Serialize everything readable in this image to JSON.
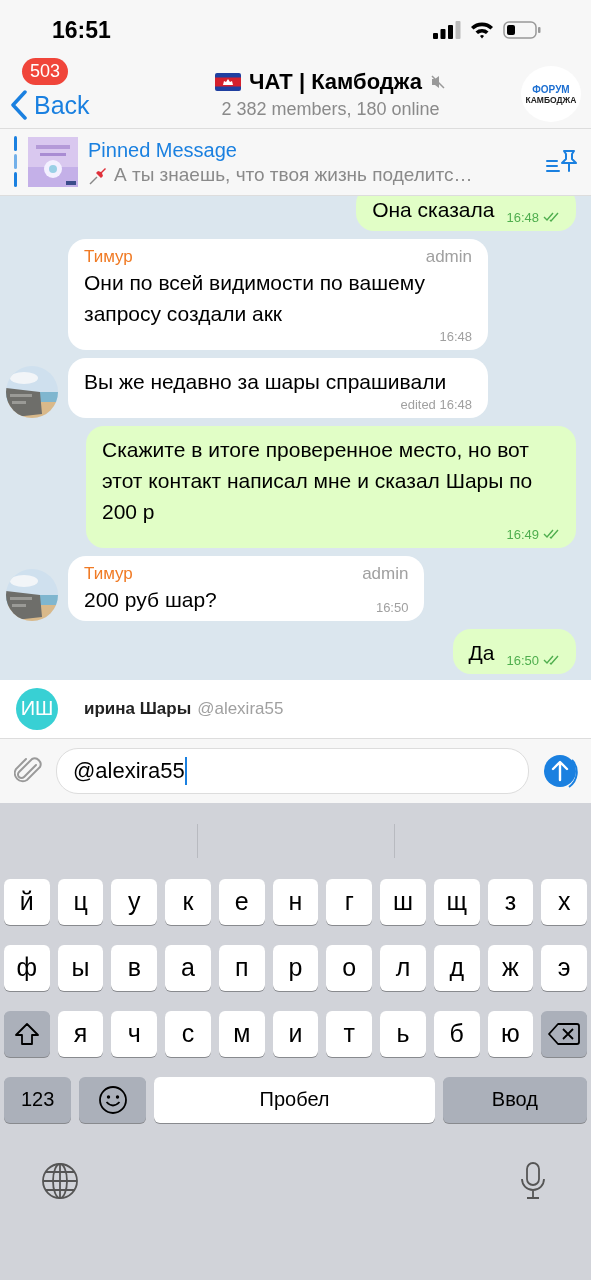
{
  "status_bar": {
    "time": "16:51"
  },
  "header": {
    "back_label": "Back",
    "unread_badge": "503",
    "title": "ЧАТ | Камбоджа",
    "muted": true,
    "subtitle": "2 382 members, 180 online",
    "logo_lines": [
      "ФОРУМ",
      "КАМБОДЖА"
    ]
  },
  "pinned": {
    "title": "Pinned Message",
    "text": "А ты знаешь, что твоя жизнь поделитс…"
  },
  "messages": [
    {
      "kind": "outgoing",
      "text": "Она сказала",
      "time": "16:48"
    },
    {
      "kind": "incoming",
      "avatar": false,
      "sender": "Тимур",
      "role": "admin",
      "text": "Они по всей видимости по вашему запросу создали акк",
      "time": "16:48"
    },
    {
      "kind": "incoming",
      "avatar": true,
      "text": "Вы же недавно за шары спрашивали",
      "time": "edited 16:48"
    },
    {
      "kind": "outgoing",
      "text": "Скажите в итоге проверенное место, но вот этот контакт написал мне и сказал Шары по 200 р",
      "time": "16:49"
    },
    {
      "kind": "incoming",
      "avatar": true,
      "sender": "Тимур",
      "role": "admin",
      "text": "200 руб шар?",
      "time": "16:50"
    },
    {
      "kind": "outgoing",
      "text": "Да",
      "time": "16:50"
    }
  ],
  "mention": {
    "initials": "ИШ",
    "name": "ирина Шары",
    "handle": "@alexira55"
  },
  "composer": {
    "value": "@alexira55"
  },
  "keyboard": {
    "rows": [
      [
        {
          "kind": "letter",
          "label": "й"
        },
        {
          "kind": "letter",
          "label": "ц"
        },
        {
          "kind": "letter",
          "label": "у"
        },
        {
          "kind": "letter",
          "label": "к"
        },
        {
          "kind": "letter",
          "label": "е"
        },
        {
          "kind": "letter",
          "label": "н"
        },
        {
          "kind": "letter",
          "label": "г"
        },
        {
          "kind": "letter",
          "label": "ш"
        },
        {
          "kind": "letter",
          "label": "щ"
        },
        {
          "kind": "letter",
          "label": "з"
        },
        {
          "kind": "letter",
          "label": "х"
        }
      ],
      [
        {
          "kind": "letter",
          "label": "ф"
        },
        {
          "kind": "letter",
          "label": "ы"
        },
        {
          "kind": "letter",
          "label": "в"
        },
        {
          "kind": "letter",
          "label": "а"
        },
        {
          "kind": "letter",
          "label": "п"
        },
        {
          "kind": "letter",
          "label": "р"
        },
        {
          "kind": "letter",
          "label": "о"
        },
        {
          "kind": "letter",
          "label": "л"
        },
        {
          "kind": "letter",
          "label": "д"
        },
        {
          "kind": "letter",
          "label": "ж"
        },
        {
          "kind": "letter",
          "label": "э"
        }
      ],
      [
        {
          "kind": "shift"
        },
        {
          "kind": "letter",
          "label": "я"
        },
        {
          "kind": "letter",
          "label": "ч"
        },
        {
          "kind": "letter",
          "label": "с"
        },
        {
          "kind": "letter",
          "label": "м"
        },
        {
          "kind": "letter",
          "label": "и"
        },
        {
          "kind": "letter",
          "label": "т"
        },
        {
          "kind": "letter",
          "label": "ь"
        },
        {
          "kind": "letter",
          "label": "б"
        },
        {
          "kind": "letter",
          "label": "ю"
        },
        {
          "kind": "backspace"
        }
      ]
    ],
    "numbers_key": "123",
    "space_key": "Пробел",
    "return_key": "Ввод"
  }
}
